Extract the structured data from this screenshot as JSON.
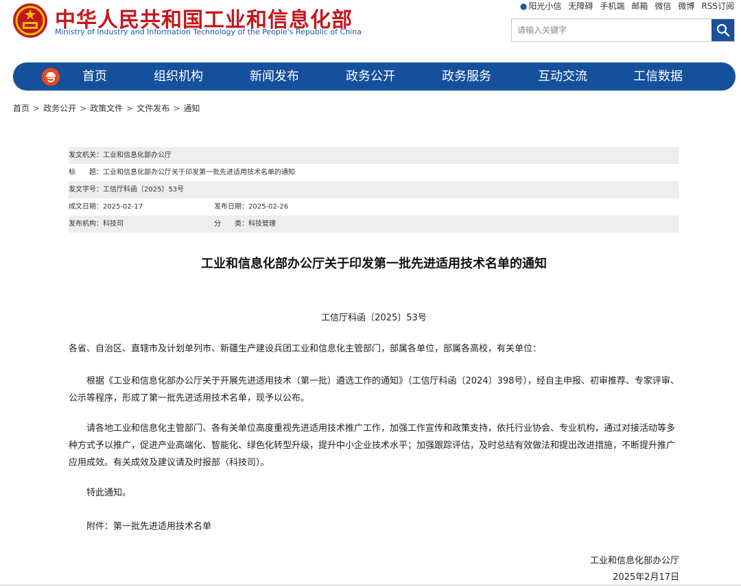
{
  "header": {
    "title_cn": "中华人民共和国工业和信息化部",
    "title_en": "Ministry of Industry and Information Technology of the People's Republic of China",
    "top_links": [
      "阳光小信",
      "无障碍",
      "手机端",
      "邮箱",
      "微信",
      "微博",
      "RSS订阅"
    ],
    "search_placeholder": "请输入关键字"
  },
  "nav": {
    "items": [
      "首页",
      "组织机构",
      "新闻发布",
      "政务公开",
      "政务服务",
      "互动交流",
      "工信数据"
    ]
  },
  "breadcrumb": [
    "首页",
    "政务公开",
    "政策文件",
    "文件发布",
    "通知"
  ],
  "meta": {
    "issuer_label": "发文机关：",
    "issuer": "工业和信息化部办公厅",
    "title_label": "标　　题：",
    "title": "工业和信息化部办公厅关于印发第一批先进适用技术名单的通知",
    "doc_no_label": "发文字号：",
    "doc_no": "工信厅科函〔2025〕53号",
    "written_label": "成文日期：",
    "written": "2025-02-17",
    "published_label": "发布日期：",
    "published": "2025-02-26",
    "publisher_label": "发布机构：",
    "publisher": "科技司",
    "category_label": "分　　类：",
    "category": "科技管理"
  },
  "doc": {
    "title": "工业和信息化部办公厅关于印发第一批先进适用技术名单的通知",
    "number": "工信厅科函〔2025〕53号",
    "salutation": "各省、自治区、直辖市及计划单列市、新疆生产建设兵团工业和信息化主管部门，部属各单位，部属各高校，有关单位：",
    "para1": "根据《工业和信息化部办公厅关于开展先进适用技术（第一批）遴选工作的通知》（工信厅科函〔2024〕398号），经自主申报、初审推荐、专家评审、公示等程序，形成了第一批先进适用技术名单，现予以公布。",
    "para2": "请各地工业和信息化主管部门、各有关单位高度重视先进适用技术推广工作，加强工作宣传和政策支持，依托行业协会、专业机构，通过对接活动等多种方式予以推广，促进产业高端化、智能化、绿色化转型升级，提升中小企业技术水平；加强跟踪评估，及时总结有效做法和提出改进措施，不断提升推广应用成效。有关成效及建议请及时报部（科技司）。",
    "closing": "特此通知。",
    "attachment": "附件：第一批先进适用技术名单",
    "sign_org": "工业和信息化部办公厅",
    "sign_date": "2025年2月17日"
  },
  "colors": {
    "brand_red": "#c4161c",
    "nav_blue": "#15509c",
    "en_blue": "#1a56a6"
  }
}
